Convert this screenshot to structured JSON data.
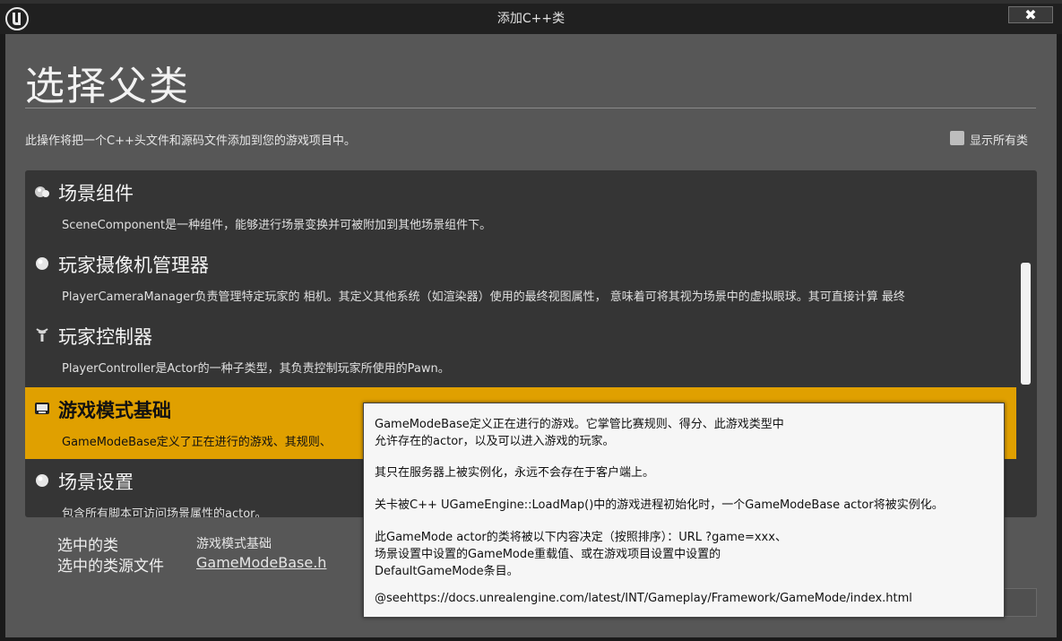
{
  "window": {
    "title": "添加C++类",
    "close_label": "✖"
  },
  "page": {
    "heading": "选择父类",
    "description": "此操作将把一个C++头文件和源码文件添加到您的游戏项目中。",
    "show_all_label": "显示所有类",
    "show_all_checked": false
  },
  "classes": [
    {
      "title": "场景组件",
      "description": "SceneComponent是一种组件，能够进行场景变换并可被附加到其他场景组件下。",
      "icon": "scene-component-icon"
    },
    {
      "title": "玩家摄像机管理器",
      "description": "PlayerCameraManager负责管理特定玩家的 相机。其定义其他系统（如渲染器）使用的最终视图属性， 意味着可将其视为场景中的虚拟眼球。其可直接计算 最终",
      "icon": "sphere-icon"
    },
    {
      "title": "玩家控制器",
      "description": "PlayerController是Actor的一种子类型，其负责控制玩家所使用的Pawn。",
      "icon": "player-controller-icon"
    },
    {
      "title": "游戏模式基础",
      "description": "GameModeBase定义了正在进行的游戏、其规则、",
      "icon": "game-mode-icon"
    },
    {
      "title": "场景设置",
      "description": "包含所有脚本可访问场景属性的actor。",
      "icon": "sphere-icon"
    }
  ],
  "selection": {
    "class_label": "选中的类",
    "class_value": "游戏模式基础",
    "source_label": "选中的类源文件",
    "source_value": "GameModeBase.h"
  },
  "tooltip": {
    "lines": [
      "GameModeBase定义正在进行的游戏。它掌管比赛规则、得分、此游戏类型中",
      "允许存在的actor，以及可以进入游戏的玩家。",
      "其只在服务器上被实例化，永远不会存在于客户端上。",
      "关卡被C++ UGameEngine::LoadMap()中的游戏进程初始化时，一个GameModeBase actor将被实例化。",
      "此GameMode actor的类将被以下内容决定（按照排序）：URL ?game=xxx、",
      "场景设置中设置的GameMode重载值、或在游戏项目设置中设置的",
      "DefaultGameMode条目。",
      "@seehttps://docs.unrealengine.com/latest/INT/Gameplay/Framework/GameMode/index.html"
    ]
  },
  "colors": {
    "selected_row": "#e0a000",
    "list_bg": "#353535",
    "panel_bg": "#575757"
  }
}
